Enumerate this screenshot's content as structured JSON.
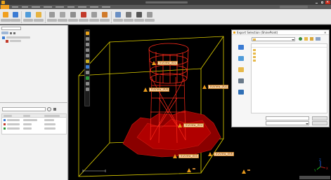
{
  "colors": {
    "points": "#b00000",
    "points_dark": "#5a0000",
    "points_bright": "#ff2a1a",
    "bbox": "#e0d000",
    "tag_fill": "#ffd9a8",
    "tag_border": "#c27f2e",
    "warning": "#e89a1b",
    "axis_x": "#e02020",
    "axis_y": "#20c020",
    "axis_z": "#2060e0"
  },
  "titlebar": {
    "icons": [
      "app-logo-icon",
      "minimize-icon",
      "maximize-icon",
      "close-icon"
    ]
  },
  "ribbon": {
    "tab_count": 10,
    "groups": [
      {
        "icons": [
          "import-icon",
          "export-icon"
        ]
      },
      {
        "icons": [
          "create-project-icon",
          "open-project-icon"
        ]
      },
      {
        "icons": [
          "scan-icon",
          "register-icon",
          "clean-icon",
          "mesh-icon",
          "measure-icon",
          "segment-icon"
        ]
      },
      {
        "icons": [
          "flythrough-icon",
          "photo-icon",
          "video-icon",
          "settings-icon"
        ]
      }
    ]
  },
  "left_panel": {
    "tree_rows": 2,
    "search_value": "",
    "table_rows": 4
  },
  "viewport": {
    "labels": [
      {
        "text": "TruView_001"
      },
      {
        "text": "TruView_004"
      },
      {
        "text": "TruView_003"
      },
      {
        "text": "TruView_002"
      },
      {
        "text": "TruView_005"
      },
      {
        "text": "TruView_006"
      },
      {
        "text": ""
      },
      {
        "text": ""
      }
    ],
    "scale_text": "",
    "axes": {
      "x": "X",
      "y": "Y",
      "z": "Z"
    }
  },
  "dialog": {
    "title": "Export Selection (ShinePoint)",
    "close_glyph": "✕",
    "lookin_label": "",
    "lookin_value": "",
    "places": [
      {
        "icon": "recent-places-icon",
        "label": ""
      },
      {
        "icon": "desktop-icon",
        "label": ""
      },
      {
        "icon": "libraries-icon",
        "label": ""
      },
      {
        "icon": "computer-icon",
        "label": ""
      },
      {
        "icon": "network-icon",
        "label": ""
      }
    ],
    "columns": [
      "",
      "",
      ""
    ],
    "files": [
      {
        "name": "",
        "date": "",
        "type": ""
      },
      {
        "name": "",
        "date": "",
        "type": ""
      },
      {
        "name": "",
        "date": "",
        "type": ""
      },
      {
        "name": "",
        "date": "",
        "type": ""
      }
    ],
    "filename_label": "",
    "filename_value": "",
    "filetype_label": "",
    "filetype_value": "",
    "save_label": "",
    "cancel_label": ""
  },
  "statusbar": {
    "right_text": ""
  }
}
